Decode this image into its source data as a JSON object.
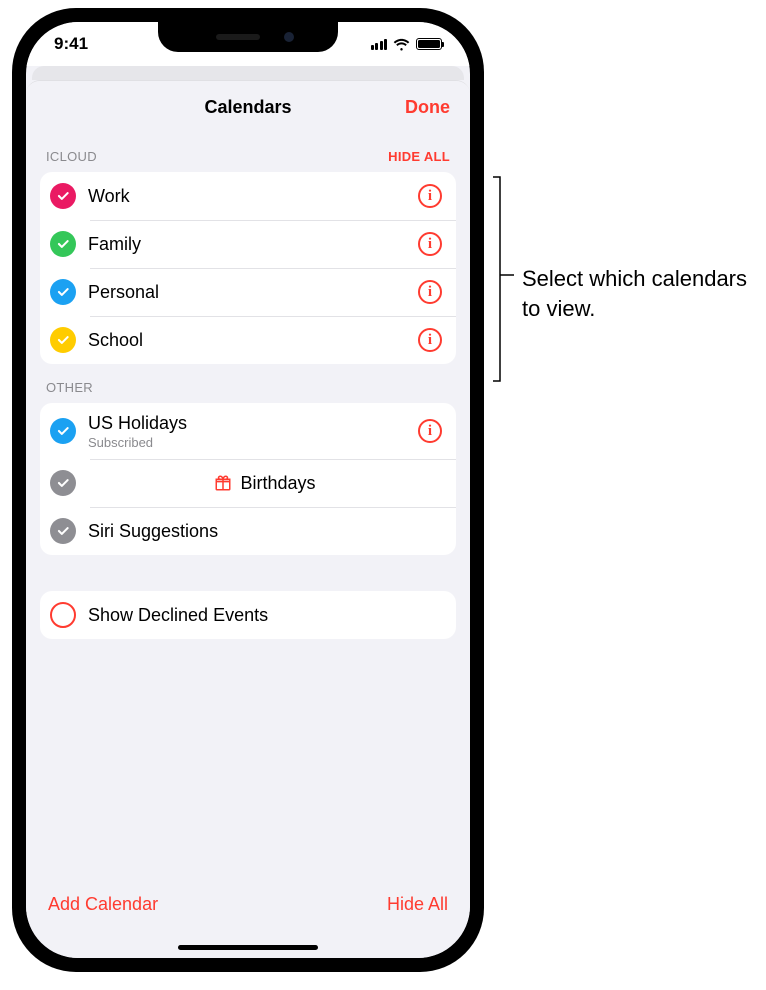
{
  "status": {
    "time": "9:41"
  },
  "nav": {
    "title": "Calendars",
    "done": "Done"
  },
  "sections": {
    "icloud": {
      "header": "ICLOUD",
      "hide_all": "HIDE ALL",
      "items": [
        {
          "label": "Work",
          "color": "#ea1a63"
        },
        {
          "label": "Family",
          "color": "#34c759"
        },
        {
          "label": "Personal",
          "color": "#1ba1f2"
        },
        {
          "label": "School",
          "color": "#ffcc00"
        }
      ]
    },
    "other": {
      "header": "OTHER",
      "items": [
        {
          "label": "US Holidays",
          "sub": "Subscribed",
          "color": "#1ba1f2",
          "info": true
        },
        {
          "label": "Birthdays",
          "color": "#8e8e93",
          "gift": true
        },
        {
          "label": "Siri Suggestions",
          "color": "#8e8e93"
        }
      ]
    },
    "declined": {
      "label": "Show Declined Events"
    }
  },
  "bottom": {
    "add": "Add Calendar",
    "hide_all": "Hide All"
  },
  "annotation": {
    "text": "Select which calendars to view."
  }
}
